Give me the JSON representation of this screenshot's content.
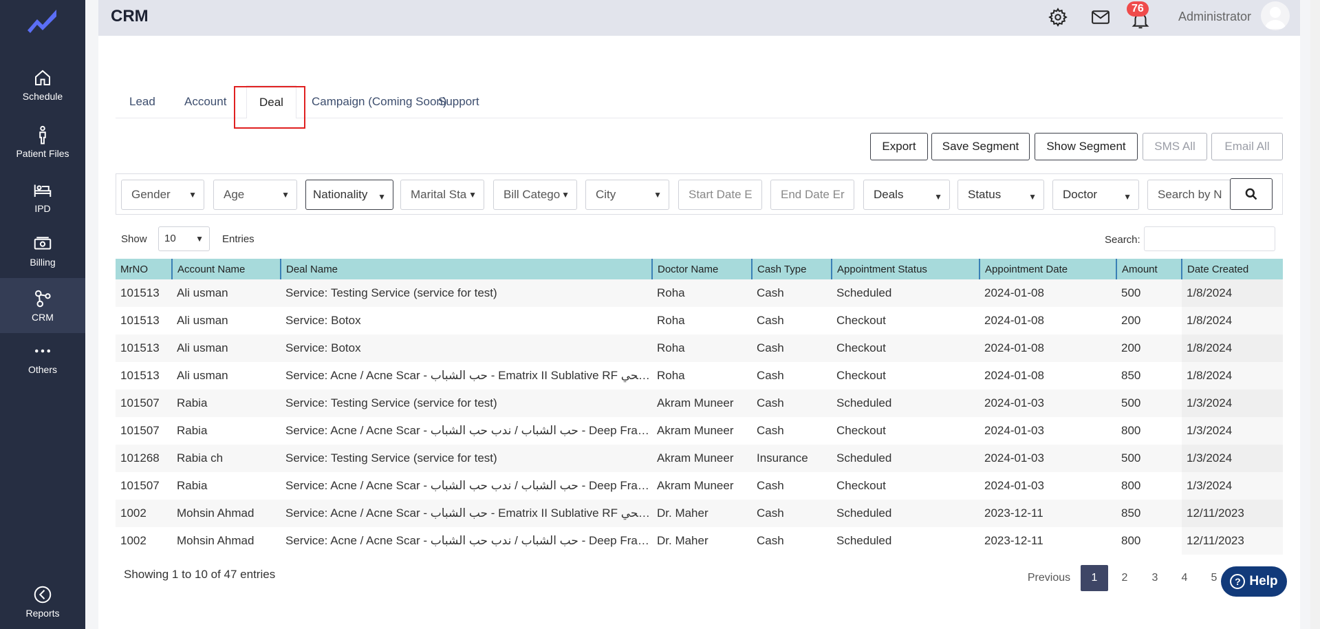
{
  "sidebar": {
    "items": [
      {
        "label": "Schedule",
        "icon": "home-icon"
      },
      {
        "label": "Patient Files",
        "icon": "person-icon"
      },
      {
        "label": "IPD",
        "icon": "bed-icon"
      },
      {
        "label": "Billing",
        "icon": "cash-icon"
      },
      {
        "label": "CRM",
        "icon": "crm-nodes-icon"
      },
      {
        "label": "Others",
        "icon": "more-dots-icon"
      },
      {
        "label": "Reports",
        "icon": "chart-pie-icon"
      }
    ],
    "active": "CRM"
  },
  "header": {
    "title": "CRM",
    "notification_count": "76",
    "user_name": "Administrator"
  },
  "tabs": [
    {
      "label": "Lead"
    },
    {
      "label": "Account"
    },
    {
      "label": "Deal"
    },
    {
      "label": "Campaign (Coming Soon)"
    },
    {
      "label": "Support"
    }
  ],
  "active_tab": "Deal",
  "actions": {
    "export": "Export",
    "save_segment": "Save Segment",
    "show_segment": "Show Segment",
    "sms_all": "SMS All",
    "email_all": "Email All"
  },
  "filters": {
    "gender": "Gender",
    "age": "Age",
    "nationality": "Nationality",
    "marital_status": "Marital Sta",
    "bill_category": "Bill Catego",
    "city": "City",
    "start_date": "Start Date E",
    "end_date": "End Date Er",
    "deals": "Deals",
    "status": "Status",
    "doctor": "Doctor",
    "search_by": "Search by N"
  },
  "table_controls": {
    "show_label": "Show",
    "entries_value": "10",
    "entries_label": "Entries",
    "search_label": "Search:"
  },
  "table": {
    "columns": [
      "MrNO",
      "Account Name",
      "Deal Name",
      "Doctor Name",
      "Cash Type",
      "Appointment Status",
      "Appointment Date",
      "Amount",
      "Date Created"
    ],
    "rows": [
      [
        "101513",
        "Ali usman",
        "Service: Testing Service (service for test)",
        "Roha",
        "Cash",
        "Scheduled",
        "2024-01-08",
        "500",
        "1/8/2024"
      ],
      [
        "101513",
        "Ali usman",
        "Service: Botox",
        "Roha",
        "Cash",
        "Checkout",
        "2024-01-08",
        "200",
        "1/8/2024"
      ],
      [
        "101513",
        "Ali usman",
        "Service: Botox",
        "Roha",
        "Cash",
        "Checkout",
        "2024-01-08",
        "200",
        "1/8/2024"
      ],
      [
        "101513",
        "Ali usman",
        "Service: Acne / Acne Scar - حب الشباب - Ematrix II Sublative RF طحي...",
        "Roha",
        "Cash",
        "Checkout",
        "2024-01-08",
        "850",
        "1/8/2024"
      ],
      [
        "101507",
        "Rabia",
        "Service: Testing Service (service for test)",
        "Akram Muneer",
        "Cash",
        "Scheduled",
        "2024-01-03",
        "500",
        "1/3/2024"
      ],
      [
        "101507",
        "Rabia",
        "Service: Acne / Acne Scar - حب الشباب / ندب حب الشباب - Deep Fraction...",
        "Akram Muneer",
        "Cash",
        "Checkout",
        "2024-01-03",
        "800",
        "1/3/2024"
      ],
      [
        "101268",
        "Rabia ch",
        "Service: Testing Service (service for test)",
        "Akram Muneer",
        "Insurance",
        "Scheduled",
        "2024-01-03",
        "500",
        "1/3/2024"
      ],
      [
        "101507",
        "Rabia",
        "Service: Acne / Acne Scar - حب الشباب / ندب حب الشباب - Deep Fraction...",
        "Akram Muneer",
        "Cash",
        "Checkout",
        "2024-01-03",
        "800",
        "1/3/2024"
      ],
      [
        "1002",
        "Mohsin Ahmad",
        "Service: Acne / Acne Scar - حب الشباب - Ematrix II Sublative RF طحي...",
        "Dr. Maher",
        "Cash",
        "Scheduled",
        "2023-12-11",
        "850",
        "12/11/2023"
      ],
      [
        "1002",
        "Mohsin Ahmad",
        "Service: Acne / Acne Scar - حب الشباب / ندب حب الشباب - Deep Fraction...",
        "Dr. Maher",
        "Cash",
        "Scheduled",
        "2023-12-11",
        "800",
        "12/11/2023"
      ]
    ]
  },
  "footer": {
    "showing": "Showing 1 to 10 of 47 entries",
    "pagination": [
      "Previous",
      "1",
      "2",
      "3",
      "4",
      "5"
    ],
    "active_page": "1",
    "help_label": "Help"
  },
  "colors": {
    "sidebar_bg": "#262e42",
    "table_header_bg": "#a7dadb",
    "highlight_border": "#e02020",
    "badge_bg": "#ef4b4b",
    "help_bg": "#123a7a"
  }
}
